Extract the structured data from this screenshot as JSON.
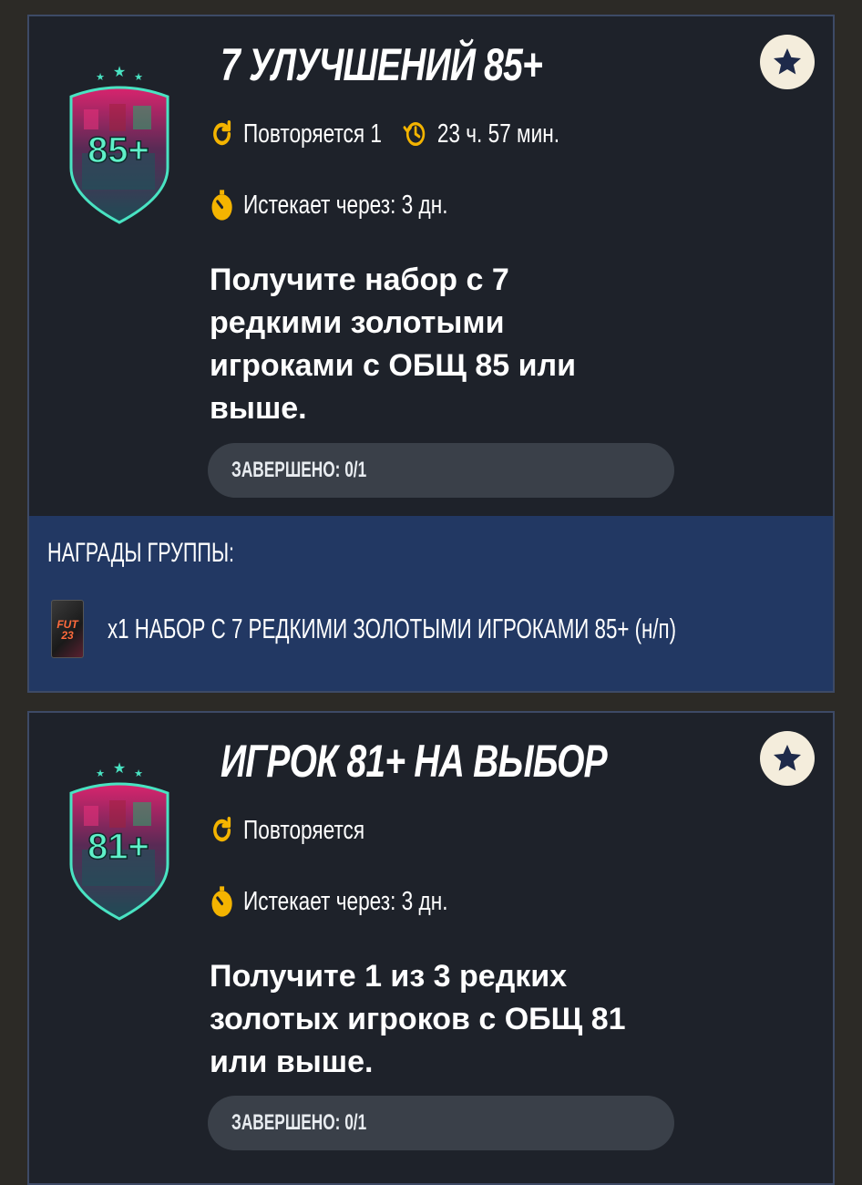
{
  "colors": {
    "background": "#2c2a26",
    "card": "#1e222a",
    "card_border": "#3d4a66",
    "rewards_bg": "#223863",
    "progress_bg": "#3a4049",
    "repeat_icon": "#f4b400",
    "timer_icon": "#f4b400",
    "favorite_bg": "#f4eddc",
    "favorite_star": "#1e2a4a",
    "badge_teal": "#49e3c2",
    "badge_pink": "#e2307a"
  },
  "objectives": [
    {
      "badge_value": "85+",
      "title": "7 УЛУЧШЕНИЙ 85+",
      "favorite_icon": "star-icon",
      "repeat_icon": "refresh-icon",
      "repeat_text": "Повторяется 1",
      "cooldown_icon": "clock-history-icon",
      "cooldown_text": "23 ч. 57 мин.",
      "expiry_icon": "stopwatch-icon",
      "expiry_text": "Истекает через: 3 дн.",
      "description": "Получите набор с 7 редкими золотыми игроками с ОБЩ 85 или выше.",
      "progress_text": "ЗАВЕРШЕНО: 0/1",
      "progress": 0,
      "rewards_title": "НАГРАДЫ ГРУППЫ:",
      "reward_icon": "pack-icon",
      "reward_pack_text": "FUT 23",
      "reward_label": "x1 НАБОР С 7 РЕДКИМИ ЗОЛОТЫМИ ИГРОКАМИ 85+ (н/п)"
    },
    {
      "badge_value": "81+",
      "title": "ИГРОК 81+ НА ВЫБОР",
      "favorite_icon": "star-icon",
      "repeat_icon": "refresh-icon",
      "repeat_text": "Повторяется",
      "expiry_icon": "stopwatch-icon",
      "expiry_text": "Истекает через: 3 дн.",
      "description": "Получите 1 из 3 редких золотых игроков с ОБЩ 81 или выше.",
      "progress_text": "ЗАВЕРШЕНО: 0/1",
      "progress": 0
    }
  ]
}
